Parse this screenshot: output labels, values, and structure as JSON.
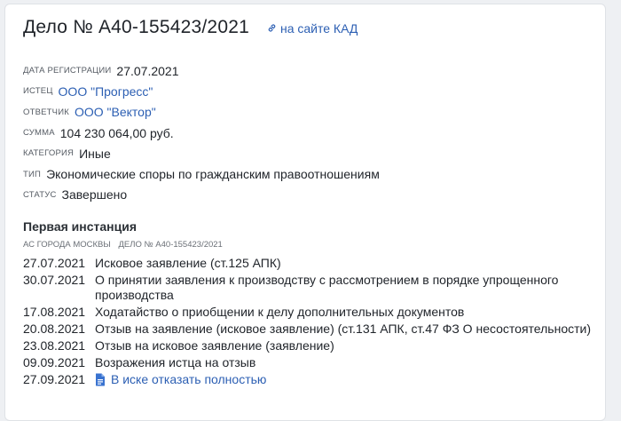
{
  "header": {
    "case_title": "Дело № А40-155423/2021",
    "kad_link_label": "на сайте КАД"
  },
  "fields": [
    {
      "label": "Дата регистрации",
      "value": "27.07.2021"
    },
    {
      "label": "Истец",
      "value": "ООО \"Прогресс\""
    },
    {
      "label": "Ответчик",
      "value": "ООО \"Вектор\""
    },
    {
      "label": "Сумма",
      "value": "104 230 064,00 руб."
    },
    {
      "label": "Категория",
      "value": "Иные"
    },
    {
      "label": "Тип",
      "value": "Экономические споры по гражданским правоотношениям"
    },
    {
      "label": "Статус",
      "value": "Завершено"
    }
  ],
  "instance": {
    "title": "Первая инстанция",
    "court": "АС города Москвы",
    "case_ref": "Дело № А40-155423/2021",
    "events": [
      {
        "date": "27.07.2021",
        "text": "Исковое заявление (ст.125 АПК)"
      },
      {
        "date": "30.07.2021",
        "text": "О принятии заявления к производству с рассмотрением в порядке упрощенного производства"
      },
      {
        "date": "17.08.2021",
        "text": "Ходатайство о приобщении к делу дополнительных документов"
      },
      {
        "date": "20.08.2021",
        "text": "Отзыв на заявление (исковое заявление) (ст.131 АПК, ст.47 ФЗ О несостоятельности)"
      },
      {
        "date": "23.08.2021",
        "text": "Отзыв на исковое заявление (заявление)"
      },
      {
        "date": "09.09.2021",
        "text": "Возражения истца на отзыв"
      },
      {
        "date": "27.09.2021",
        "text": "В иске отказать полностью",
        "icon": "document-icon"
      }
    ]
  },
  "colors": {
    "link": "#2c5fb3",
    "text": "#1f2329",
    "label": "#555b63"
  }
}
